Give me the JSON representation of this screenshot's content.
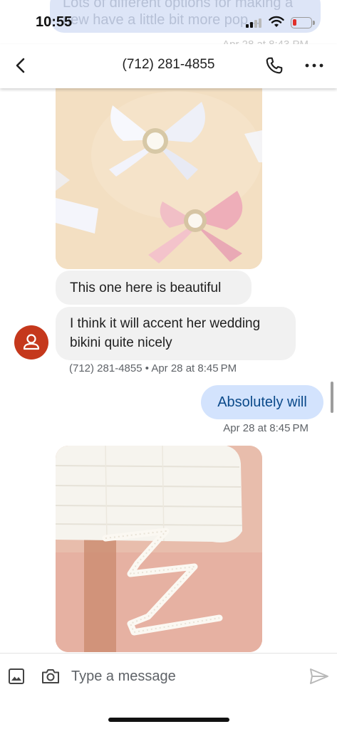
{
  "status_bar": {
    "time": "10:55"
  },
  "scrolled_previous": {
    "text": "Lots of different options for making a new have a little bit more pop...",
    "timestamp": "Apr 28 at 8:43 PM"
  },
  "app_bar": {
    "title": "(712) 281-4855"
  },
  "messages": [
    {
      "type": "image",
      "direction": "incoming",
      "icon": "satin-bows-photo"
    },
    {
      "type": "text",
      "direction": "incoming",
      "text": "This one here is beautiful"
    },
    {
      "type": "text",
      "direction": "incoming",
      "text": "I think it will accent her wedding bikini quite nicely"
    },
    {
      "type": "meta",
      "direction": "incoming",
      "text": "(712) 281-4855 • Apr 28 at 8:45 PM"
    },
    {
      "type": "text",
      "direction": "outgoing",
      "text": "Absolutely will"
    },
    {
      "type": "meta",
      "direction": "outgoing",
      "text": "Apr 28 at 8:45 PM"
    },
    {
      "type": "image",
      "direction": "incoming",
      "icon": "lace-trim-photo"
    }
  ],
  "compose": {
    "placeholder": "Type a message"
  },
  "colors": {
    "incoming_bubble": "#f1f1f1",
    "outgoing_bubble": "#d3e3fd",
    "outgoing_text": "#0b4a8a",
    "avatar": "#c5381c",
    "battery_low": "#e0302b"
  }
}
